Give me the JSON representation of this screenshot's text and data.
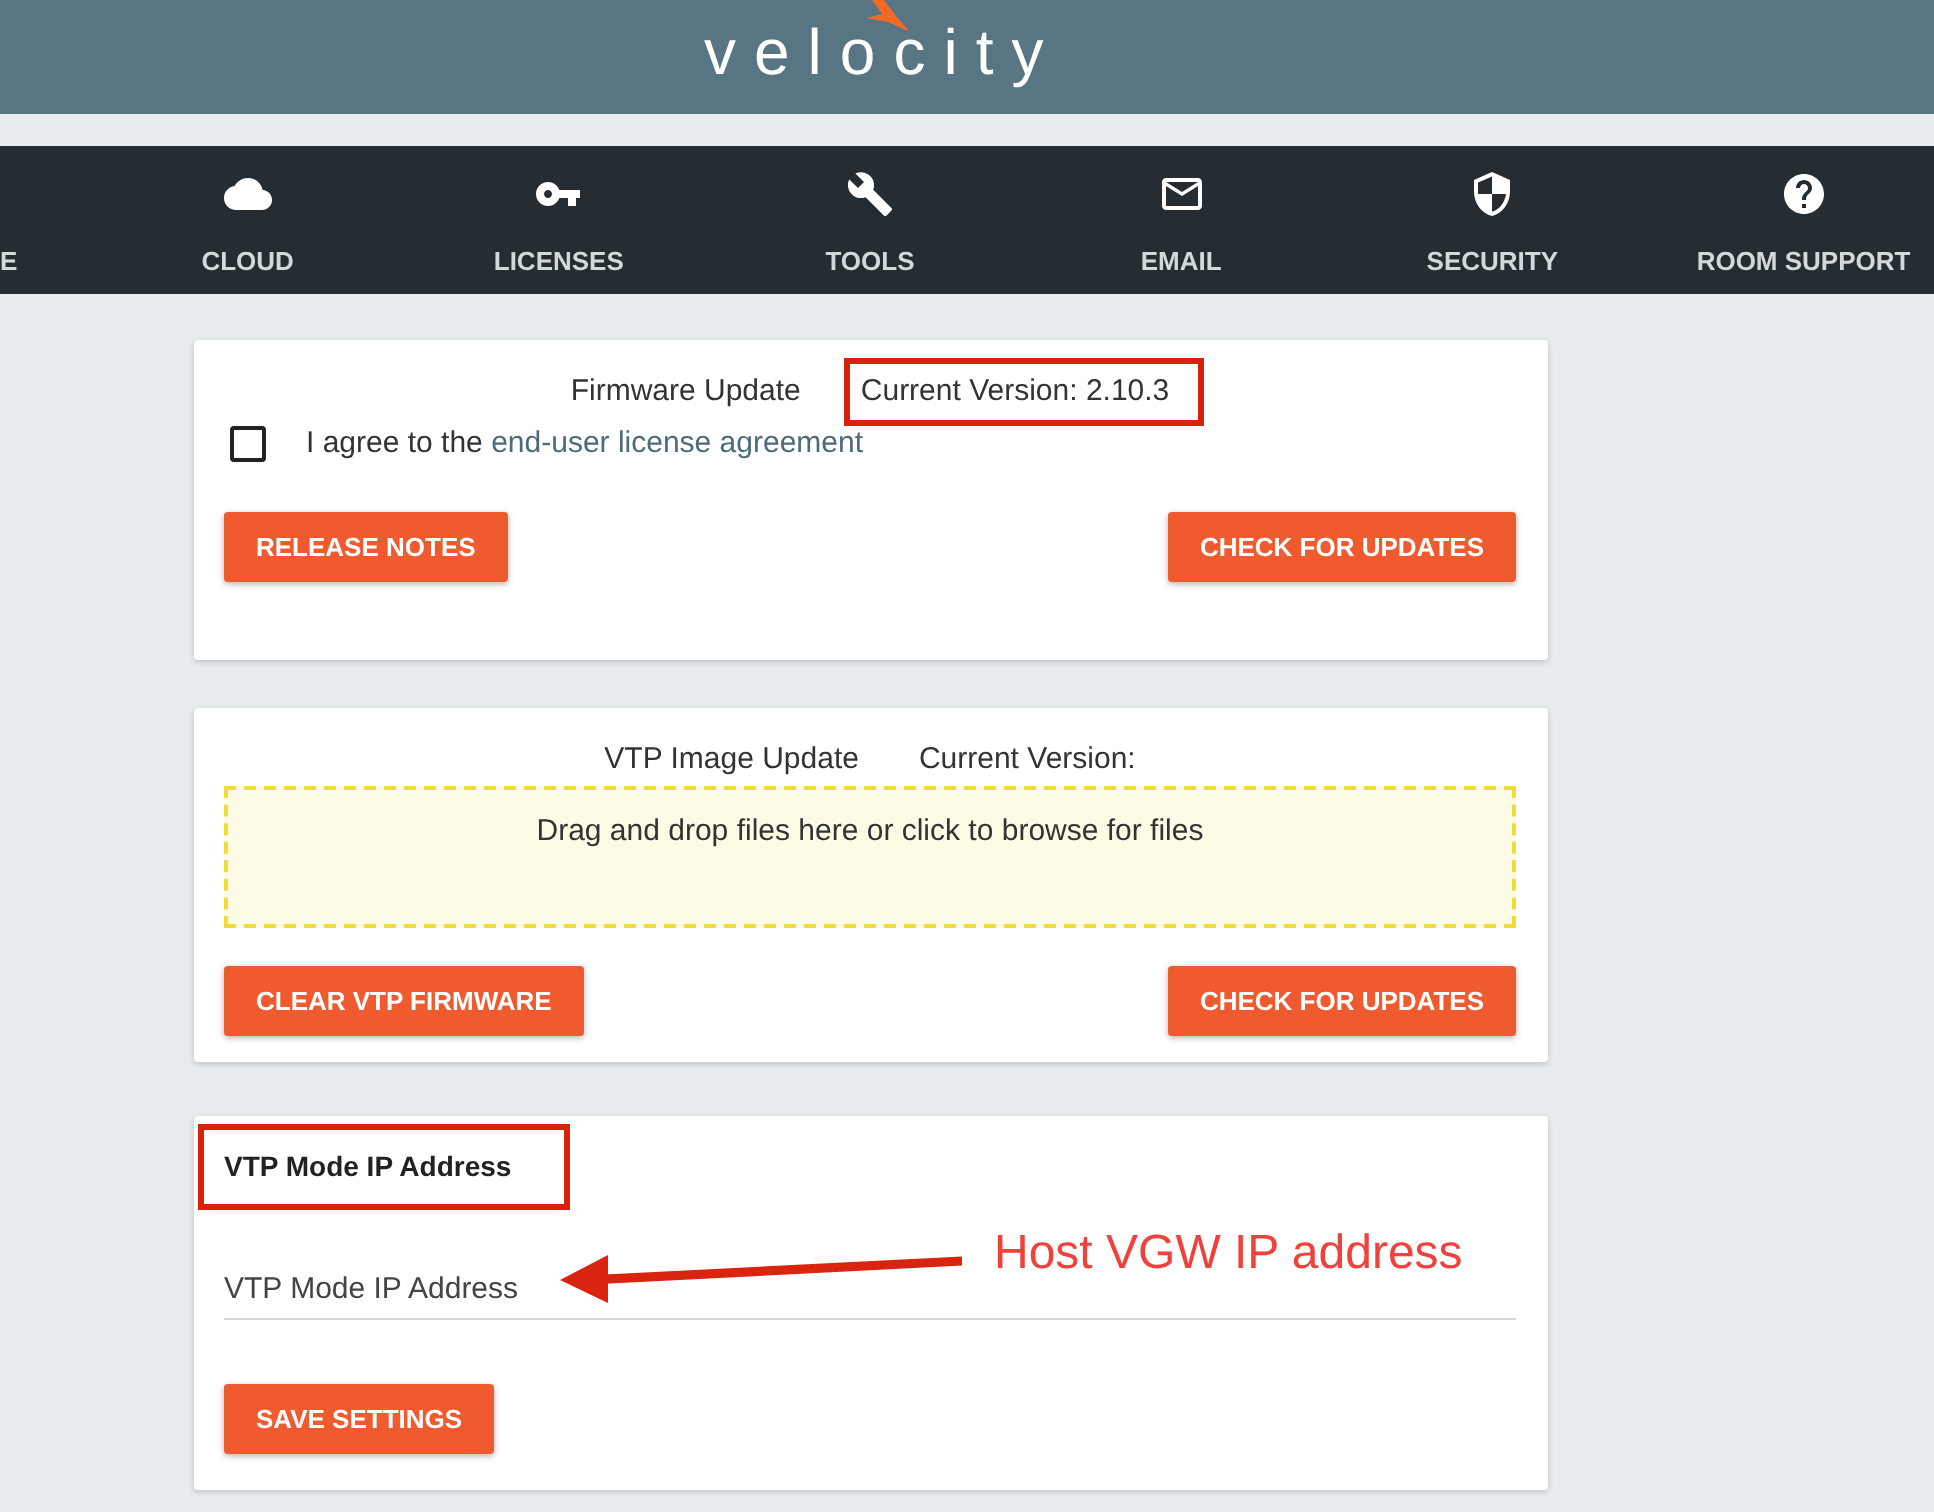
{
  "header": {
    "logo": "velocity"
  },
  "nav": {
    "items": [
      {
        "label": "E"
      },
      {
        "label": "CLOUD"
      },
      {
        "label": "LICENSES"
      },
      {
        "label": "TOOLS"
      },
      {
        "label": "EMAIL"
      },
      {
        "label": "SECURITY"
      },
      {
        "label": "ROOM SUPPORT"
      }
    ]
  },
  "firmware_card": {
    "title": "Firmware Update",
    "current_version": {
      "text": "Current Version: 2.10.3",
      "highlighted": true
    },
    "agreement": {
      "checked": false,
      "text": "I agree to the ",
      "link": "end-user license agreement"
    },
    "buttons": [
      "RELEASE NOTES",
      "CHECK FOR UPDATES"
    ]
  },
  "vtp_image_card": {
    "title": "VTP Image Update",
    "current_version": {
      "text": "Current Version:"
    },
    "drop_zone": {
      "text": "Drag and drop files here or click to browse for files"
    },
    "buttons": [
      "CLEAR VTP FIRMWARE",
      "CHECK FOR UPDATES"
    ]
  },
  "vtp_mode_card": {
    "title": {
      "text": "VTP Mode IP Address",
      "highlighted": true
    },
    "ip_field": {
      "placeholder": "VTP Mode IP Address"
    },
    "buttons": [
      "SAVE SETTINGS"
    ],
    "annotation": {
      "text": "Host VGW IP address"
    }
  }
}
